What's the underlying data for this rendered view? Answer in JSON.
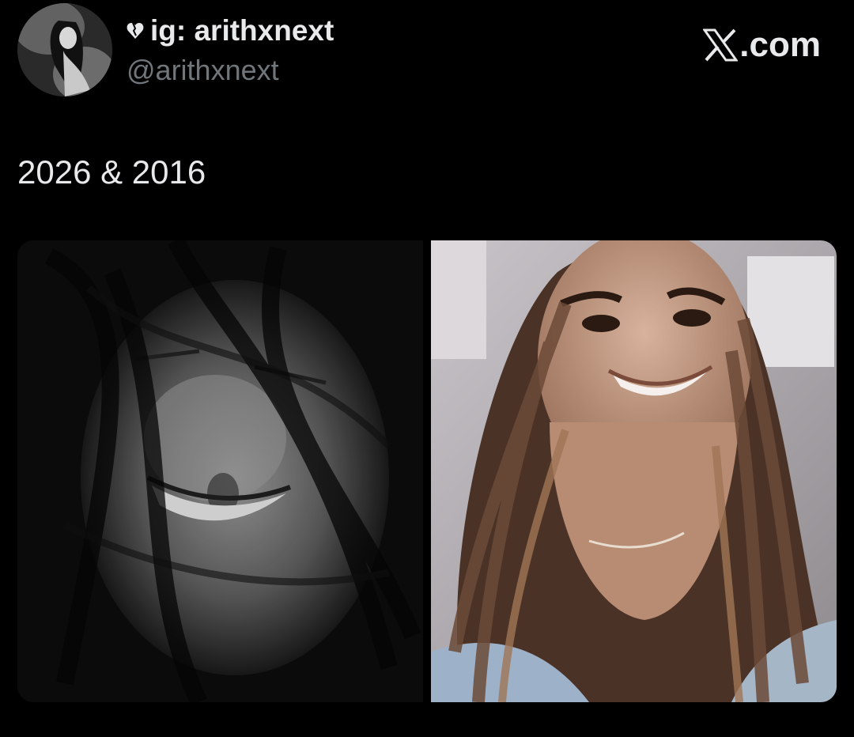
{
  "tweet": {
    "display_name": "ig: arithxnext",
    "handle": "@arithxnext",
    "text": "2026 & 2016"
  },
  "watermark": {
    "site": ".com",
    "logo_icon": "x-logo-icon"
  },
  "icons": {
    "badge": "black-heart-icon"
  },
  "media": [
    {
      "label": "photo-2026",
      "style": "black-and-white"
    },
    {
      "label": "photo-2016",
      "style": "color"
    }
  ],
  "colors": {
    "background": "#000000",
    "primary_text": "#e7e9ea",
    "secondary_text": "#71767b"
  }
}
